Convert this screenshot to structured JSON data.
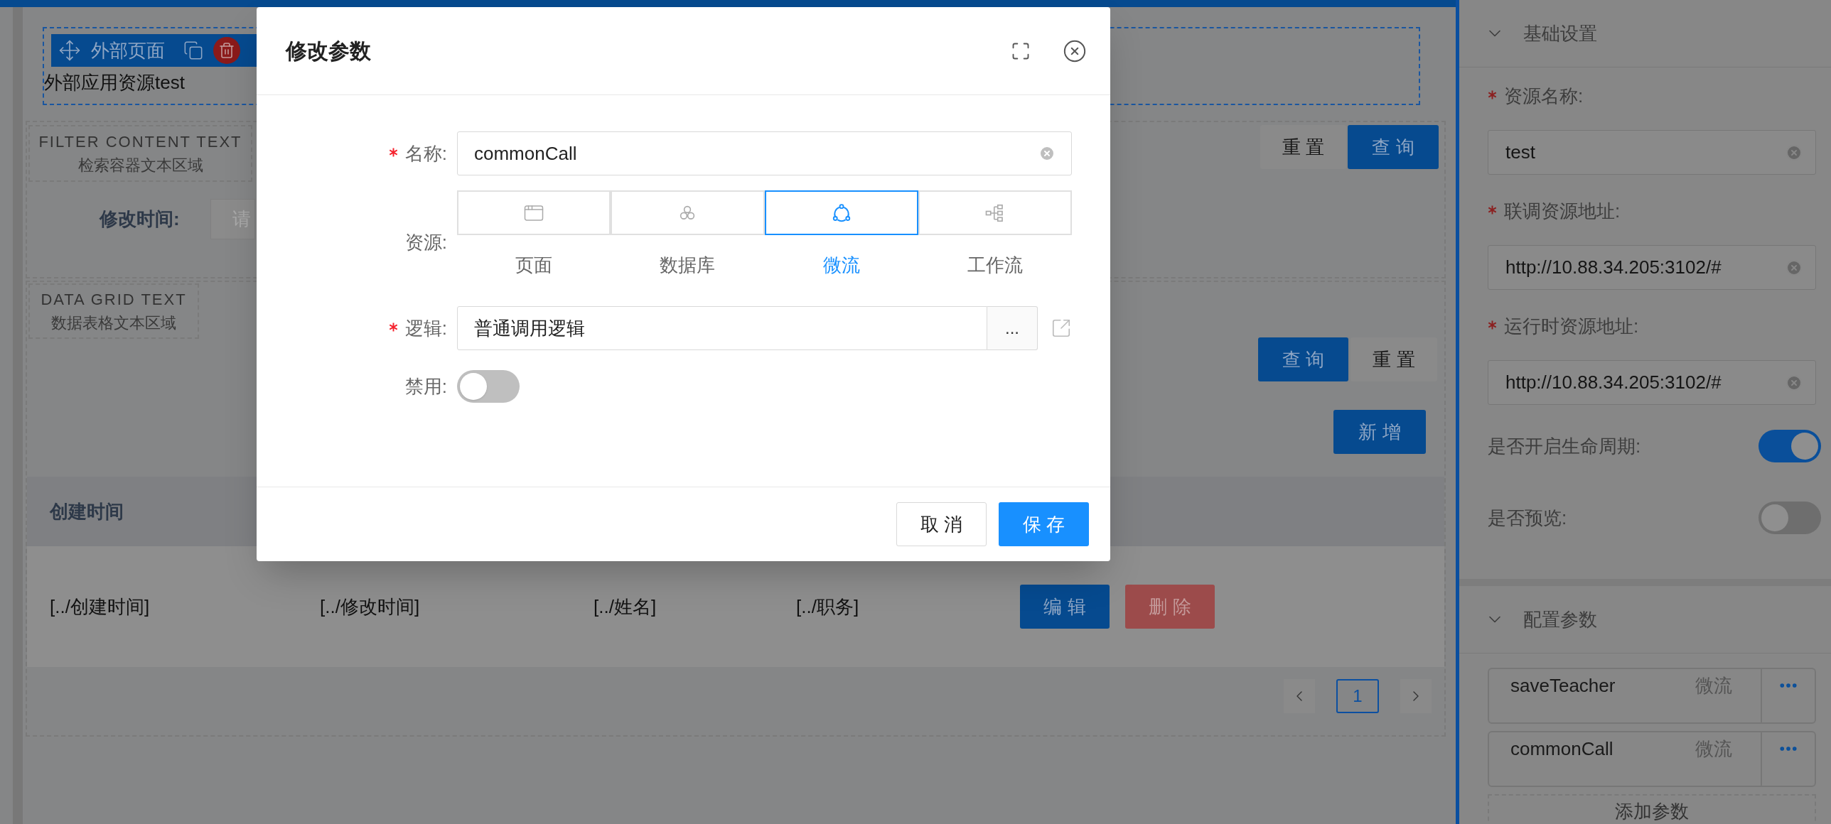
{
  "canvas": {
    "external_page": {
      "toolbar_label": "外部页面",
      "text": "外部应用资源test"
    },
    "filter": {
      "caption_en": "FILTER CONTENT TEXT",
      "caption_zh": "检索容器文本区域",
      "buttons": [
        {
          "label": "重 置",
          "kind": "default"
        },
        {
          "label": "查 询",
          "kind": "primary"
        }
      ],
      "field": {
        "label": "修改时间:",
        "placeholder": "请"
      }
    },
    "data_grid": {
      "caption_en": "DATA GRID TEXT",
      "caption_zh": "数据表格文本区域",
      "buttons": [
        {
          "label": "查 询",
          "kind": "primary"
        },
        {
          "label": "重 置",
          "kind": "default"
        }
      ],
      "add_button": "新 增",
      "columns": [
        "创建时间"
      ],
      "rows": [
        {
          "cells": [
            "[../创建时间]",
            "[../修改时间]",
            "[../姓名]",
            "[../职务]"
          ],
          "actions": [
            {
              "label": "编 辑",
              "kind": "primary"
            },
            {
              "label": "删 除",
              "kind": "danger"
            }
          ]
        }
      ],
      "pagination": {
        "pages": [
          {
            "label": "1",
            "selected": true
          }
        ]
      }
    }
  },
  "sidebar": {
    "sections": [
      {
        "title": "基础设置",
        "expanded": true,
        "fields": [
          {
            "kind": "input",
            "label": "资源名称:",
            "required": true,
            "value": "test"
          },
          {
            "kind": "input",
            "label": "联调资源地址:",
            "required": true,
            "value": "http://10.88.34.205:3102/#"
          },
          {
            "kind": "input",
            "label": "运行时资源地址:",
            "required": true,
            "value": "http://10.88.34.205:3102/#"
          },
          {
            "kind": "switch",
            "label": "是否开启生命周期:",
            "on": true
          },
          {
            "kind": "switch",
            "label": "是否预览:",
            "on": false
          }
        ]
      },
      {
        "title": "配置参数",
        "expanded": true,
        "params": [
          {
            "name": "saveTeacher",
            "type": "微流"
          },
          {
            "name": "commonCall",
            "type": "微流"
          }
        ],
        "add_button": "添加参数"
      }
    ]
  },
  "dialog": {
    "title": "修改参数",
    "name": {
      "label": "名称:",
      "required": true,
      "value": "commonCall"
    },
    "resource": {
      "label": "资源:",
      "options": [
        {
          "kind": "page",
          "label": "页面",
          "selected": false
        },
        {
          "kind": "database",
          "label": "数据库",
          "selected": false
        },
        {
          "kind": "microflow",
          "label": "微流",
          "selected": true
        },
        {
          "kind": "workflow",
          "label": "工作流",
          "selected": false
        }
      ]
    },
    "logic": {
      "label": "逻辑:",
      "required": true,
      "value": "普通调用逻辑",
      "browse_button": "..."
    },
    "disabled": {
      "label": "禁用:",
      "on": false
    },
    "buttons": [
      {
        "label": "取 消",
        "kind": "default"
      },
      {
        "label": "保 存",
        "kind": "primary"
      }
    ]
  }
}
